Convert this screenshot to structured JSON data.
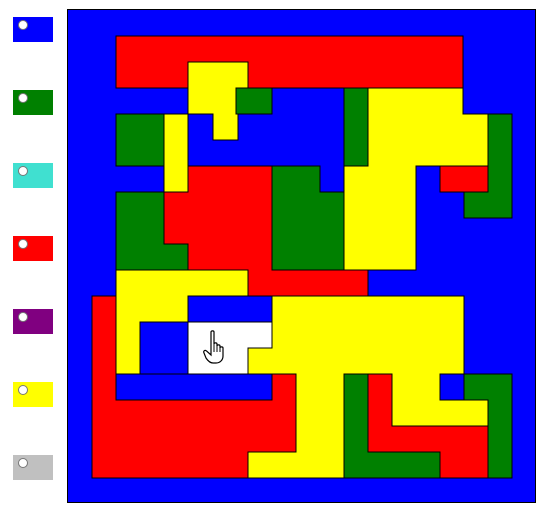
{
  "palette": {
    "colors": [
      {
        "name": "blue",
        "hex": "#0000ff"
      },
      {
        "name": "green",
        "hex": "#008000"
      },
      {
        "name": "cyan",
        "hex": "#40e0d0"
      },
      {
        "name": "red",
        "hex": "#ff0000"
      },
      {
        "name": "purple",
        "hex": "#800080"
      },
      {
        "name": "yellow",
        "hex": "#ffff00"
      },
      {
        "name": "gray",
        "hex": "#c0c0c0"
      }
    ]
  },
  "board": {
    "background": "#0000ff",
    "colors": {
      "blue": "#0000ff",
      "red": "#ff0000",
      "yellow": "#ffff00",
      "green": "#008000",
      "white": "#ffffff"
    },
    "selected_region": "white"
  },
  "cursor": {
    "icon": "hand-pointer-icon"
  }
}
